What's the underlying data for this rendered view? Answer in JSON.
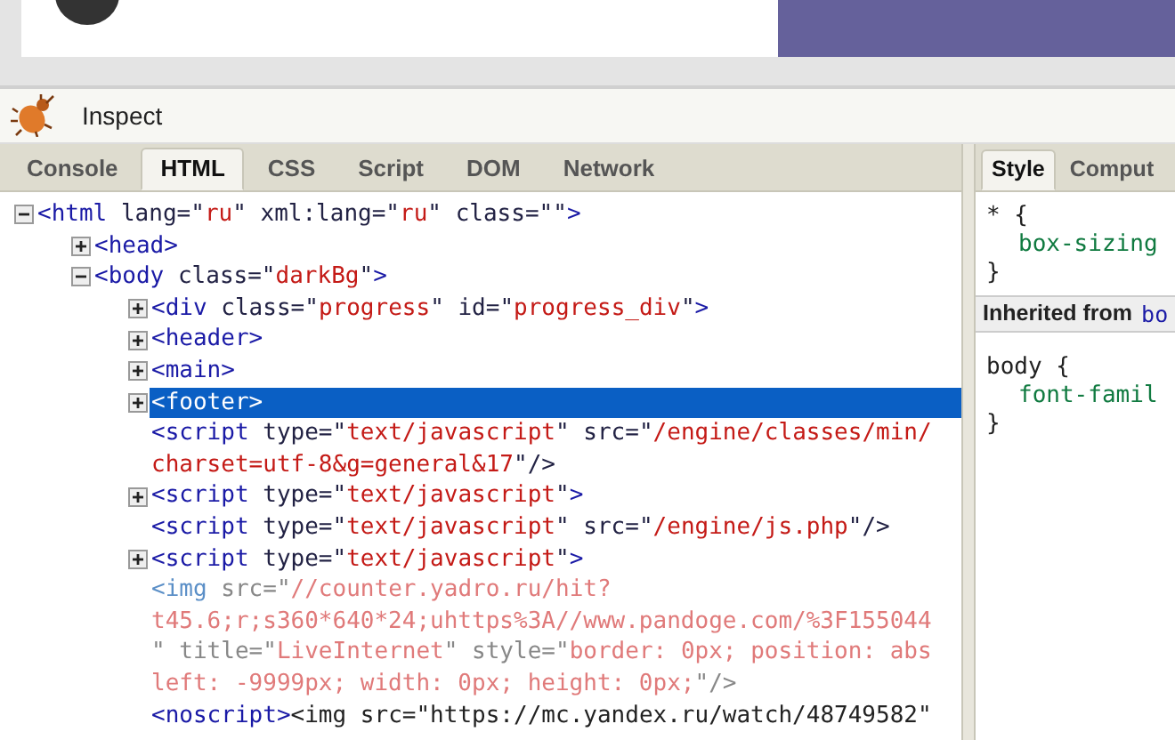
{
  "toolbar": {
    "title": "Inspect"
  },
  "tabs": [
    {
      "label": "Console",
      "selected": false
    },
    {
      "label": "HTML",
      "selected": true
    },
    {
      "label": "CSS",
      "selected": false
    },
    {
      "label": "Script",
      "selected": false
    },
    {
      "label": "DOM",
      "selected": false
    },
    {
      "label": "Network",
      "selected": false
    }
  ],
  "tree": [
    {
      "expanded": true,
      "selected": false,
      "lines": [
        [
          {
            "kind": "tag",
            "text": "<html"
          },
          {
            "kind": "attr",
            "text": " lang=\""
          },
          {
            "kind": "value",
            "text": "ru"
          },
          {
            "kind": "attr",
            "text": "\" xml:lang=\""
          },
          {
            "kind": "value",
            "text": "ru"
          },
          {
            "kind": "attr",
            "text": "\" class=\"\""
          },
          {
            "kind": "tag",
            "text": ">"
          }
        ]
      ],
      "children": [
        {
          "expanded": false,
          "selected": false,
          "lines": [
            [
              {
                "kind": "tag",
                "text": "<head>"
              }
            ]
          ]
        },
        {
          "expanded": true,
          "selected": false,
          "lines": [
            [
              {
                "kind": "tag",
                "text": "<body"
              },
              {
                "kind": "attr",
                "text": " class=\""
              },
              {
                "kind": "value",
                "text": "darkBg"
              },
              {
                "kind": "attr",
                "text": "\""
              },
              {
                "kind": "tag",
                "text": ">"
              }
            ]
          ],
          "children": [
            {
              "expanded": false,
              "selected": false,
              "lines": [
                [
                  {
                    "kind": "tag",
                    "text": "<div"
                  },
                  {
                    "kind": "attr",
                    "text": " class=\""
                  },
                  {
                    "kind": "value",
                    "text": "progress"
                  },
                  {
                    "kind": "attr",
                    "text": "\" id=\""
                  },
                  {
                    "kind": "value",
                    "text": "progress_div"
                  },
                  {
                    "kind": "attr",
                    "text": "\""
                  },
                  {
                    "kind": "tag",
                    "text": ">"
                  }
                ]
              ]
            },
            {
              "expanded": false,
              "selected": false,
              "lines": [
                [
                  {
                    "kind": "tag",
                    "text": "<header>"
                  }
                ]
              ]
            },
            {
              "expanded": false,
              "selected": false,
              "lines": [
                [
                  {
                    "kind": "tag",
                    "text": "<main>"
                  }
                ]
              ]
            },
            {
              "expanded": false,
              "selected": true,
              "lines": [
                [
                  {
                    "kind": "tag",
                    "text": "<footer>"
                  }
                ]
              ]
            },
            {
              "selected": false,
              "lines": [
                [
                  {
                    "kind": "tag",
                    "text": "<script"
                  },
                  {
                    "kind": "attr",
                    "text": " type=\""
                  },
                  {
                    "kind": "value",
                    "text": "text/javascript"
                  },
                  {
                    "kind": "attr",
                    "text": "\" src=\""
                  },
                  {
                    "kind": "value",
                    "text": "/engine/classes/min/"
                  }
                ],
                [
                  {
                    "kind": "value",
                    "text": "charset=utf-8&g=general&17"
                  },
                  {
                    "kind": "attr",
                    "text": "\"/>"
                  }
                ]
              ]
            },
            {
              "expanded": false,
              "selected": false,
              "lines": [
                [
                  {
                    "kind": "tag",
                    "text": "<script"
                  },
                  {
                    "kind": "attr",
                    "text": " type=\""
                  },
                  {
                    "kind": "value",
                    "text": "text/javascript"
                  },
                  {
                    "kind": "attr",
                    "text": "\""
                  },
                  {
                    "kind": "tag",
                    "text": ">"
                  }
                ]
              ]
            },
            {
              "selected": false,
              "lines": [
                [
                  {
                    "kind": "tag",
                    "text": "<script"
                  },
                  {
                    "kind": "attr",
                    "text": " type=\""
                  },
                  {
                    "kind": "value",
                    "text": "text/javascript"
                  },
                  {
                    "kind": "attr",
                    "text": "\" src=\""
                  },
                  {
                    "kind": "value",
                    "text": "/engine/js.php"
                  },
                  {
                    "kind": "attr",
                    "text": "\"/>"
                  }
                ]
              ]
            },
            {
              "expanded": false,
              "selected": false,
              "lines": [
                [
                  {
                    "kind": "tag",
                    "text": "<script"
                  },
                  {
                    "kind": "attr",
                    "text": " type=\""
                  },
                  {
                    "kind": "value",
                    "text": "text/javascript"
                  },
                  {
                    "kind": "attr",
                    "text": "\""
                  },
                  {
                    "kind": "tag",
                    "text": ">"
                  }
                ]
              ]
            },
            {
              "selected": false,
              "lines": [
                [
                  {
                    "kind": "dimtag",
                    "text": "<img"
                  },
                  {
                    "kind": "dimattr",
                    "text": " src=\""
                  },
                  {
                    "kind": "dimvalue",
                    "text": "//counter.yadro.ru/hit?"
                  }
                ],
                [
                  {
                    "kind": "dimvalue",
                    "text": "t45.6;r;s360*640*24;uhttps%3A//www.pandoge.com/%3F155044"
                  }
                ],
                [
                  {
                    "kind": "dimattr",
                    "text": "\" title=\""
                  },
                  {
                    "kind": "dimvalue",
                    "text": "LiveInternet"
                  },
                  {
                    "kind": "dimattr",
                    "text": "\" style=\""
                  },
                  {
                    "kind": "dimvalue",
                    "text": "border: 0px; position: abs"
                  }
                ],
                [
                  {
                    "kind": "dimvalue",
                    "text": "left: -9999px; width: 0px; height: 0px;"
                  },
                  {
                    "kind": "dimattr",
                    "text": "\"/>"
                  }
                ]
              ]
            },
            {
              "selected": false,
              "lines": [
                [
                  {
                    "kind": "tag",
                    "text": "<noscript>"
                  },
                  {
                    "kind": "text",
                    "text": "<img src=\"https://mc.yandex.ru/watch/48749582\""
                  }
                ]
              ]
            }
          ]
        }
      ]
    }
  ],
  "side_tabs": [
    {
      "label": "Style",
      "selected": true
    },
    {
      "label": "Comput",
      "selected": false
    }
  ],
  "style_rules": [
    {
      "selector": "* {",
      "declaration": "box-sizing",
      "close": "}"
    }
  ],
  "inherited": {
    "label": "Inherited from",
    "source": "bo"
  },
  "inherited_rules": [
    {
      "selector": "body {",
      "declaration": "font-famil",
      "close": "}"
    }
  ]
}
